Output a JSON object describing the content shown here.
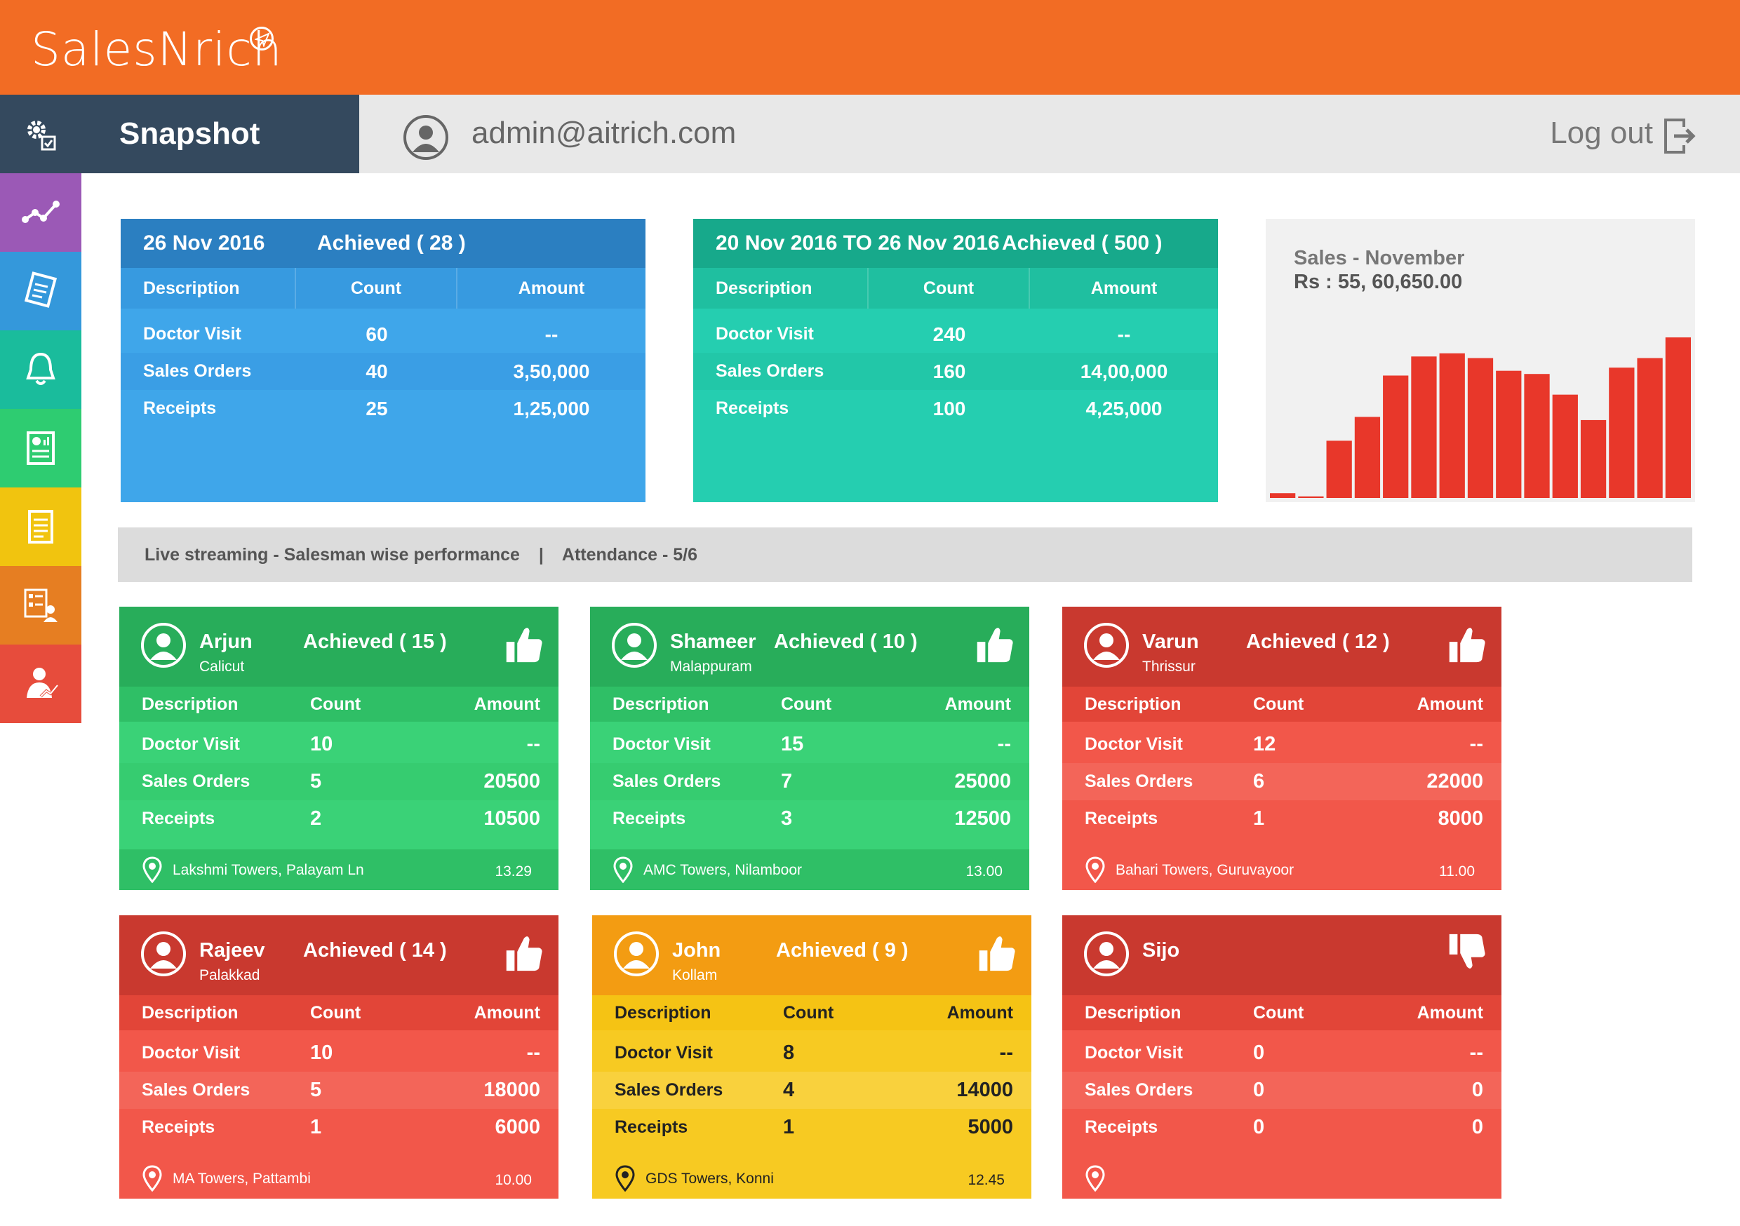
{
  "app": {
    "brand": "SalesNrich"
  },
  "header": {
    "tab_title": "Snapshot",
    "user_email": "admin@aitrich.com",
    "logout_label": "Log out"
  },
  "sidebar": {
    "items": [
      {
        "name": "settings-icon",
        "color": "#34495e"
      },
      {
        "name": "analytics-icon",
        "color": "#9b59b6"
      },
      {
        "name": "orders-icon",
        "color": "#3498db"
      },
      {
        "name": "notification-icon",
        "color": "#1abc9c"
      },
      {
        "name": "report-icon",
        "color": "#2ecc71"
      },
      {
        "name": "document-icon",
        "color": "#f1c40f"
      },
      {
        "name": "attendance-icon",
        "color": "#e67e22"
      },
      {
        "name": "performance-icon",
        "color": "#e74c3c"
      }
    ]
  },
  "summary": [
    {
      "date": "26 Nov 2016",
      "achieved": "Achieved ( 28 )",
      "columns": [
        "Description",
        "Count",
        "Amount"
      ],
      "rows": [
        {
          "desc": "Doctor Visit",
          "count": "60",
          "amount": "--"
        },
        {
          "desc": "Sales Orders",
          "count": "40",
          "amount": "3,50,000"
        },
        {
          "desc": "Receipts",
          "count": "25",
          "amount": "1,25,000"
        }
      ]
    },
    {
      "date": "20 Nov 2016 TO 26 Nov 2016",
      "achieved": "Achieved ( 500 )",
      "columns": [
        "Description",
        "Count",
        "Amount"
      ],
      "rows": [
        {
          "desc": "Doctor Visit",
          "count": "240",
          "amount": "--"
        },
        {
          "desc": "Sales Orders",
          "count": "160",
          "amount": "14,00,000"
        },
        {
          "desc": "Receipts",
          "count": "100",
          "amount": "4,25,000"
        }
      ]
    }
  ],
  "sales_chart": {
    "title": "Sales - November",
    "subtitle": "Rs : 55, 60,650.00",
    "bar_color": "#e8372a"
  },
  "chart_data": {
    "type": "bar",
    "title": "Sales - November",
    "subtitle": "Rs : 55, 60,650.00",
    "values": [
      3,
      1,
      36,
      51,
      77,
      89,
      91,
      88,
      80,
      78,
      65,
      49,
      82,
      88,
      101
    ],
    "ylim": [
      0,
      105
    ],
    "grid": false,
    "legend": false
  },
  "live_bar": {
    "label": "Live streaming - Salesman wise performance",
    "separator": "|",
    "attendance": "Attendance - 5/6"
  },
  "salesmen": [
    {
      "name": "Arjun",
      "city": "Calicut",
      "achieved": "Achieved ( 15 )",
      "thumb": "thumbs-up",
      "columns": [
        "Description",
        "Count",
        "Amount"
      ],
      "rows": [
        {
          "desc": "Doctor Visit",
          "count": "10",
          "amount": "--"
        },
        {
          "desc": "Sales Orders",
          "count": "5",
          "amount": "20500"
        },
        {
          "desc": "Receipts",
          "count": "2",
          "amount": "10500"
        }
      ],
      "location": "Lakshmi Towers, Palayam Ln",
      "time": "13.29"
    },
    {
      "name": "Shameer",
      "city": "Malappuram",
      "achieved": "Achieved ( 10 )",
      "thumb": "thumbs-up",
      "columns": [
        "Description",
        "Count",
        "Amount"
      ],
      "rows": [
        {
          "desc": "Doctor Visit",
          "count": "15",
          "amount": "--"
        },
        {
          "desc": "Sales Orders",
          "count": "7",
          "amount": "25000"
        },
        {
          "desc": "Receipts",
          "count": "3",
          "amount": "12500"
        }
      ],
      "location": "AMC Towers, Nilamboor",
      "time": "13.00"
    },
    {
      "name": "Varun",
      "city": "Thrissur",
      "achieved": "Achieved ( 12 )",
      "thumb": "thumbs-up",
      "columns": [
        "Description",
        "Count",
        "Amount"
      ],
      "rows": [
        {
          "desc": "Doctor Visit",
          "count": "12",
          "amount": "--"
        },
        {
          "desc": "Sales Orders",
          "count": "6",
          "amount": "22000"
        },
        {
          "desc": "Receipts",
          "count": "1",
          "amount": "8000"
        }
      ],
      "location": "Bahari Towers, Guruvayoor",
      "time": "11.00"
    },
    {
      "name": "Rajeev",
      "city": "Palakkad",
      "achieved": "Achieved ( 14 )",
      "thumb": "thumbs-up",
      "columns": [
        "Description",
        "Count",
        "Amount"
      ],
      "rows": [
        {
          "desc": "Doctor Visit",
          "count": "10",
          "amount": "--"
        },
        {
          "desc": "Sales Orders",
          "count": "5",
          "amount": "18000"
        },
        {
          "desc": "Receipts",
          "count": "1",
          "amount": "6000"
        }
      ],
      "location": "MA Towers, Pattambi",
      "time": "10.00"
    },
    {
      "name": "John",
      "city": "Kollam",
      "achieved": "Achieved ( 9 )",
      "thumb": "thumbs-up",
      "columns": [
        "Description",
        "Count",
        "Amount"
      ],
      "rows": [
        {
          "desc": "Doctor Visit",
          "count": "8",
          "amount": "--"
        },
        {
          "desc": "Sales Orders",
          "count": "4",
          "amount": "14000"
        },
        {
          "desc": "Receipts",
          "count": "1",
          "amount": "5000"
        }
      ],
      "location": "GDS Towers, Konni",
      "time": "12.45"
    },
    {
      "name": "Sijo",
      "city": "",
      "achieved": "",
      "thumb": "thumbs-down",
      "columns": [
        "Description",
        "Count",
        "Amount"
      ],
      "rows": [
        {
          "desc": "Doctor Visit",
          "count": "0",
          "amount": "--"
        },
        {
          "desc": "Sales Orders",
          "count": "0",
          "amount": "0"
        },
        {
          "desc": "Receipts",
          "count": "0",
          "amount": "0"
        }
      ],
      "location": "",
      "time": ""
    }
  ]
}
